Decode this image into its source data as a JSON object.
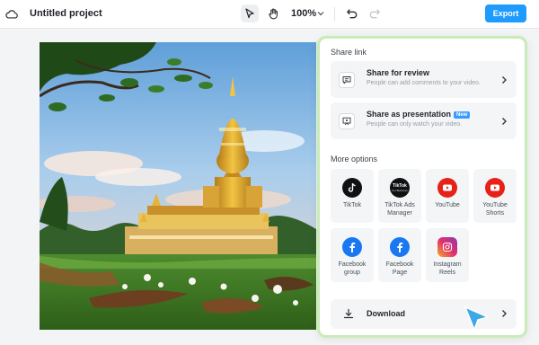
{
  "header": {
    "project_title": "Untitled project",
    "zoom": "100%",
    "export_label": "Export",
    "colors": {
      "export": "#1e9bfd"
    }
  },
  "share_panel": {
    "share_link_heading": "Share link",
    "review": {
      "title": "Share for review",
      "subtitle": "People can add comments to your video."
    },
    "presentation": {
      "title": "Share as presentation",
      "badge": "New",
      "subtitle": "People can only watch your video."
    },
    "more_options_heading": "More options",
    "options": [
      {
        "label": "TikTok",
        "icon": "tiktok-icon"
      },
      {
        "label": "TikTok Ads Manager",
        "icon": "tiktok-business-icon",
        "icon_text_1": "TikTok",
        "icon_text_2": "For Business"
      },
      {
        "label": "YouTube",
        "icon": "youtube-icon"
      },
      {
        "label": "YouTube Shorts",
        "icon": "youtube-shorts-icon"
      },
      {
        "label": "Facebook group",
        "icon": "facebook-icon"
      },
      {
        "label": "Facebook Page",
        "icon": "facebook-icon"
      },
      {
        "label": "Instagram Reels",
        "icon": "instagram-icon"
      }
    ],
    "download_label": "Download",
    "colors": {
      "panel_border": "#c8ecb6",
      "youtube": "#e62117",
      "facebook": "#1877f2",
      "new_badge": "#3a9bfd"
    }
  }
}
